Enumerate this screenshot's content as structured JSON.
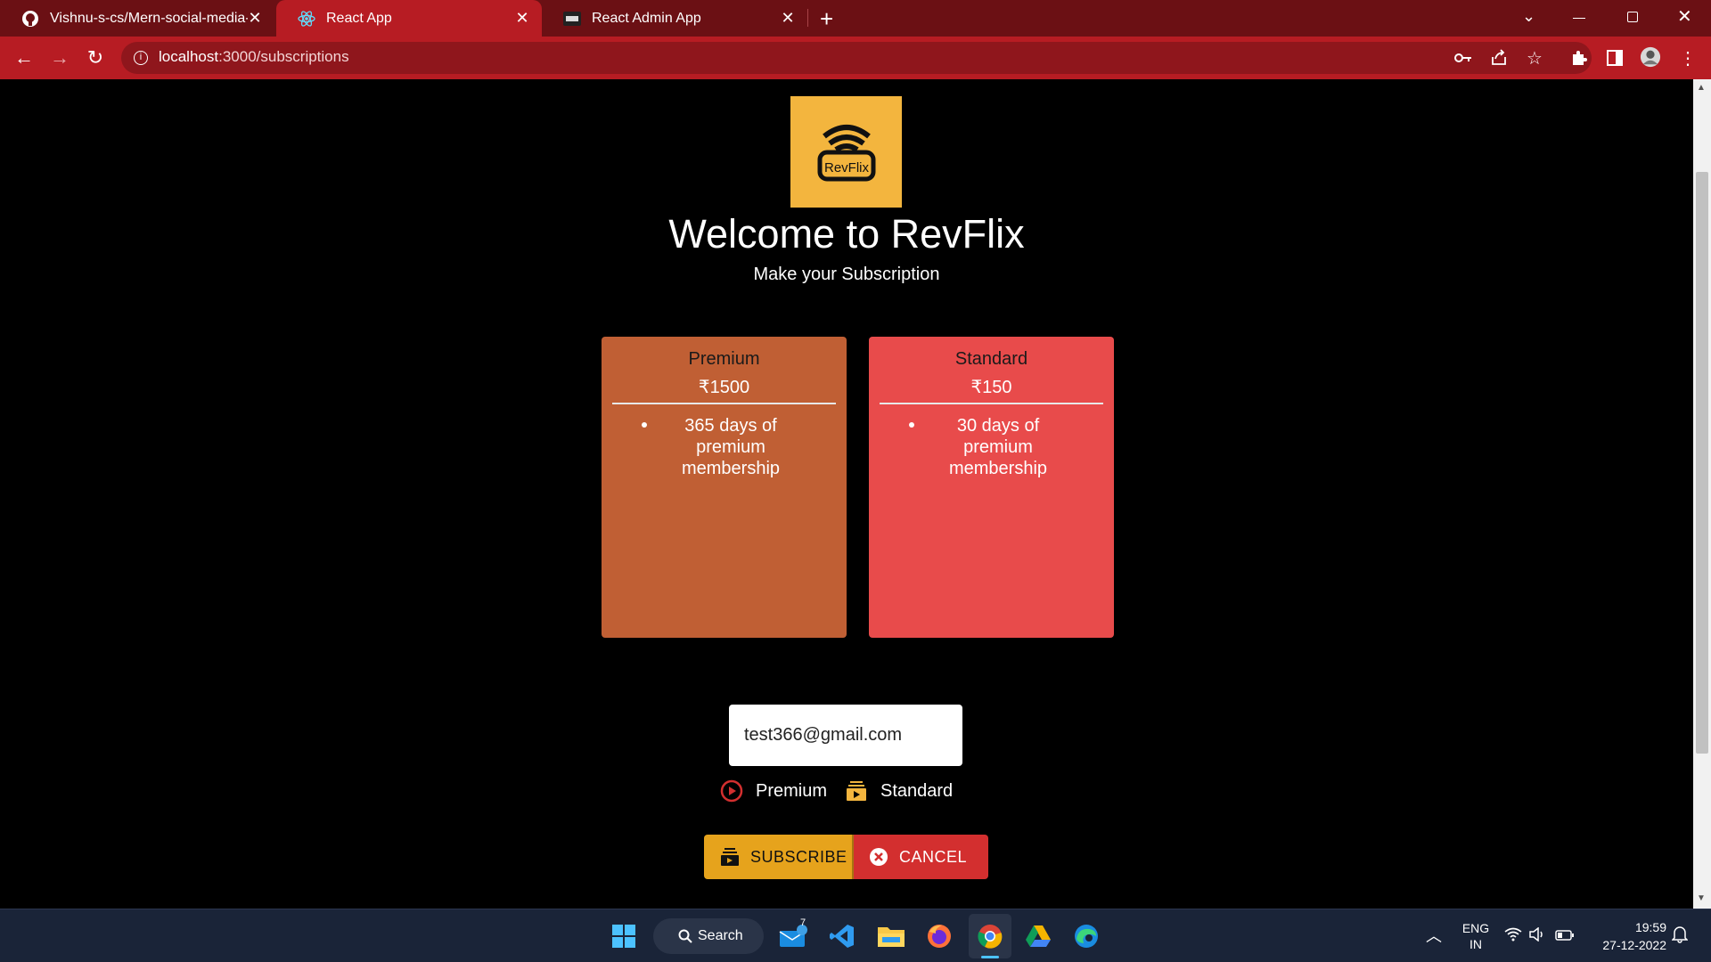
{
  "browser": {
    "tabs": [
      {
        "title": "Vishnu-s-cs/Mern-social-media-a",
        "icon": "github-icon",
        "active": false
      },
      {
        "title": "React App",
        "icon": "react-icon",
        "active": true
      },
      {
        "title": "React Admin App",
        "icon": "app-icon",
        "active": false
      }
    ],
    "url_host": "localhost",
    "url_path": ":3000/subscriptions"
  },
  "page": {
    "logo_text": "RevFlix",
    "title": "Welcome to RevFlix",
    "subtitle": "Make your Subscription",
    "plans": [
      {
        "name": "Premium",
        "price": "₹1500",
        "feature": "365 days of premium membership",
        "color": "#c05f34"
      },
      {
        "name": "Standard",
        "price": "₹150",
        "feature": "30 days of premium membership",
        "color": "#e84b4b"
      }
    ],
    "email_value": "test366@gmail.com",
    "radio_options": [
      {
        "label": "Premium",
        "icon": "play-circle-icon"
      },
      {
        "label": "Standard",
        "icon": "subscriptions-icon"
      }
    ],
    "subscribe_label": "SUBSCRIBE",
    "cancel_label": "CANCEL",
    "accent": "#e6a31c",
    "cancel_color": "#d32f2f"
  },
  "taskbar": {
    "search_label": "Search",
    "mail_badge": "7",
    "lang_top": "ENG",
    "lang_bottom": "IN",
    "time": "19:59",
    "date": "27-12-2022"
  }
}
